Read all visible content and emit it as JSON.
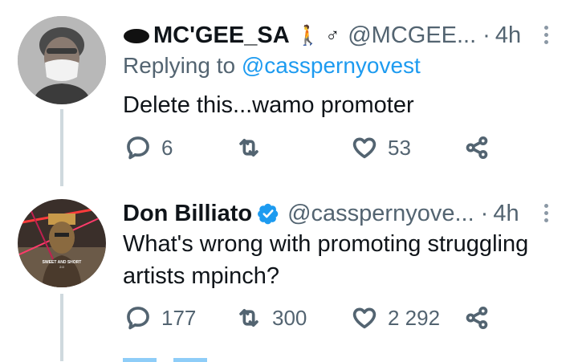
{
  "tweets": [
    {
      "name": "MC'GEE_SA",
      "emoji": "🚶 ♂",
      "handle": "@MCGEE...",
      "separator": "·",
      "time": "4h",
      "replying_prefix": "Replying to",
      "replying_to": "@casspernyovest",
      "text": "Delete this...wamo promoter",
      "replies": "6",
      "retweets": "",
      "likes": "53"
    },
    {
      "name": "Don Billiato",
      "verified": true,
      "handle": "@casspernyove...",
      "separator": "·",
      "time": "4h",
      "text_line1": "What's wrong with promoting struggling",
      "text_line2": "artists mpinch?",
      "avatar_caption": "SWEET AND SHORT",
      "avatar_caption2": "2.0",
      "replies": "177",
      "retweets": "300",
      "likes": "2 292"
    }
  ],
  "colors": {
    "accent": "#1d9bf0",
    "secondary_text": "#536471",
    "thread_line": "#cfd9de",
    "verified": "#1d9bf0"
  }
}
